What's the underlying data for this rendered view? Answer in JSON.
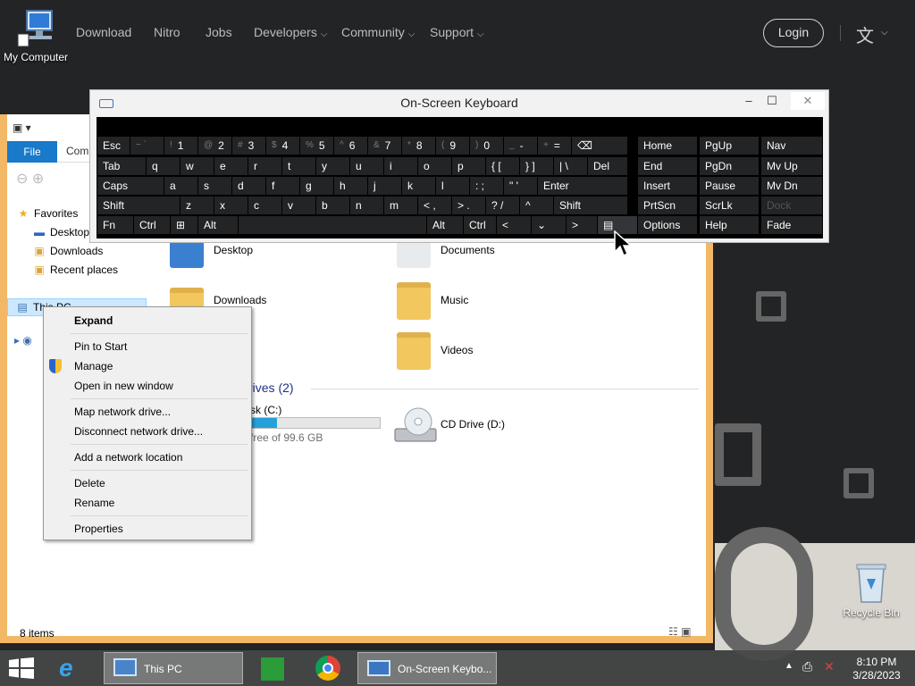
{
  "site_nav": {
    "links": [
      "Download",
      "Nitro",
      "Jobs",
      "Developers",
      "Community",
      "Support"
    ],
    "dropdown_caret": "⌵",
    "login_label": "Login",
    "language_icon": "translate-icon"
  },
  "desktop": {
    "icons": {
      "my_computer": "My Computer",
      "recycle_bin": "Recycle Bin"
    }
  },
  "explorer": {
    "tabs": {
      "file": "File",
      "computer": "Com"
    },
    "favorites": {
      "title": "Favorites",
      "items": [
        "Desktop",
        "Downloads",
        "Recent places"
      ]
    },
    "this_pc": "This PC",
    "folders": [
      "Desktop",
      "Documents",
      "Downloads",
      "Music",
      "Videos"
    ],
    "drives_header": "rives (2)",
    "drive_c": {
      "label": "sk (C:)",
      "free_text": "free of 99.6 GB",
      "used_fraction": 0.22
    },
    "drive_d": {
      "label": "CD Drive (D:)"
    },
    "status": "8 items"
  },
  "context_menu": {
    "items": [
      {
        "label": "Expand",
        "bold": true
      },
      {
        "label": "Pin to Start"
      },
      {
        "label": "Manage",
        "icon": "shield-icon"
      },
      {
        "label": "Open in new window"
      },
      {
        "label": "Map network drive..."
      },
      {
        "label": "Disconnect network drive..."
      },
      {
        "label": "Add a network location"
      },
      {
        "label": "Delete"
      },
      {
        "label": "Rename"
      },
      {
        "label": "Properties"
      }
    ]
  },
  "osk": {
    "title": "On-Screen Keyboard",
    "controls": {
      "minimize": "–",
      "maximize": "☐",
      "close": "✕"
    },
    "row1": [
      {
        "label": "Esc"
      },
      {
        "sub": "~ `",
        "label": ""
      },
      {
        "sub": "!",
        "label": "1"
      },
      {
        "sub": "@",
        "label": "2"
      },
      {
        "sub": "#",
        "label": "3"
      },
      {
        "sub": "$",
        "label": "4"
      },
      {
        "sub": "%",
        "label": "5"
      },
      {
        "sub": "^",
        "label": "6"
      },
      {
        "sub": "&",
        "label": "7"
      },
      {
        "sub": "*",
        "label": "8"
      },
      {
        "sub": "(",
        "label": "9"
      },
      {
        "sub": ")",
        "label": "0"
      },
      {
        "sub": "_",
        "label": "-"
      },
      {
        "sub": "+",
        "label": "="
      },
      {
        "label": "⌫"
      }
    ],
    "row2": [
      "Tab",
      "q",
      "w",
      "e",
      "r",
      "t",
      "y",
      "u",
      "i",
      "o",
      "p",
      "{ [",
      "} ]",
      "| \\",
      "Del"
    ],
    "row3": [
      "Caps",
      "a",
      "s",
      "d",
      "f",
      "g",
      "h",
      "j",
      "k",
      "l",
      ": ;",
      "\" '",
      "Enter"
    ],
    "row4": [
      "Shift",
      "z",
      "x",
      "c",
      "v",
      "b",
      "n",
      "m",
      "< ,",
      "> .",
      "? /",
      "^",
      "Shift"
    ],
    "row5": [
      "Fn",
      "Ctrl",
      "⊞",
      "Alt",
      "",
      "Alt",
      "Ctrl",
      "<",
      "⌄",
      ">",
      "▤"
    ],
    "right_col1": [
      "Home",
      "End",
      "Insert",
      "PrtScn",
      "Options"
    ],
    "right_col2": [
      "PgUp",
      "PgDn",
      "Pause",
      "ScrLk",
      "Help"
    ],
    "right_col3": [
      "Nav",
      "Mv Up",
      "Mv Dn",
      "Dock",
      "Fade"
    ]
  },
  "taskbar": {
    "buttons": {
      "this_pc": "This PC",
      "osk": "On-Screen Keybo..."
    },
    "time": "8:10 PM",
    "date": "3/28/2023"
  }
}
